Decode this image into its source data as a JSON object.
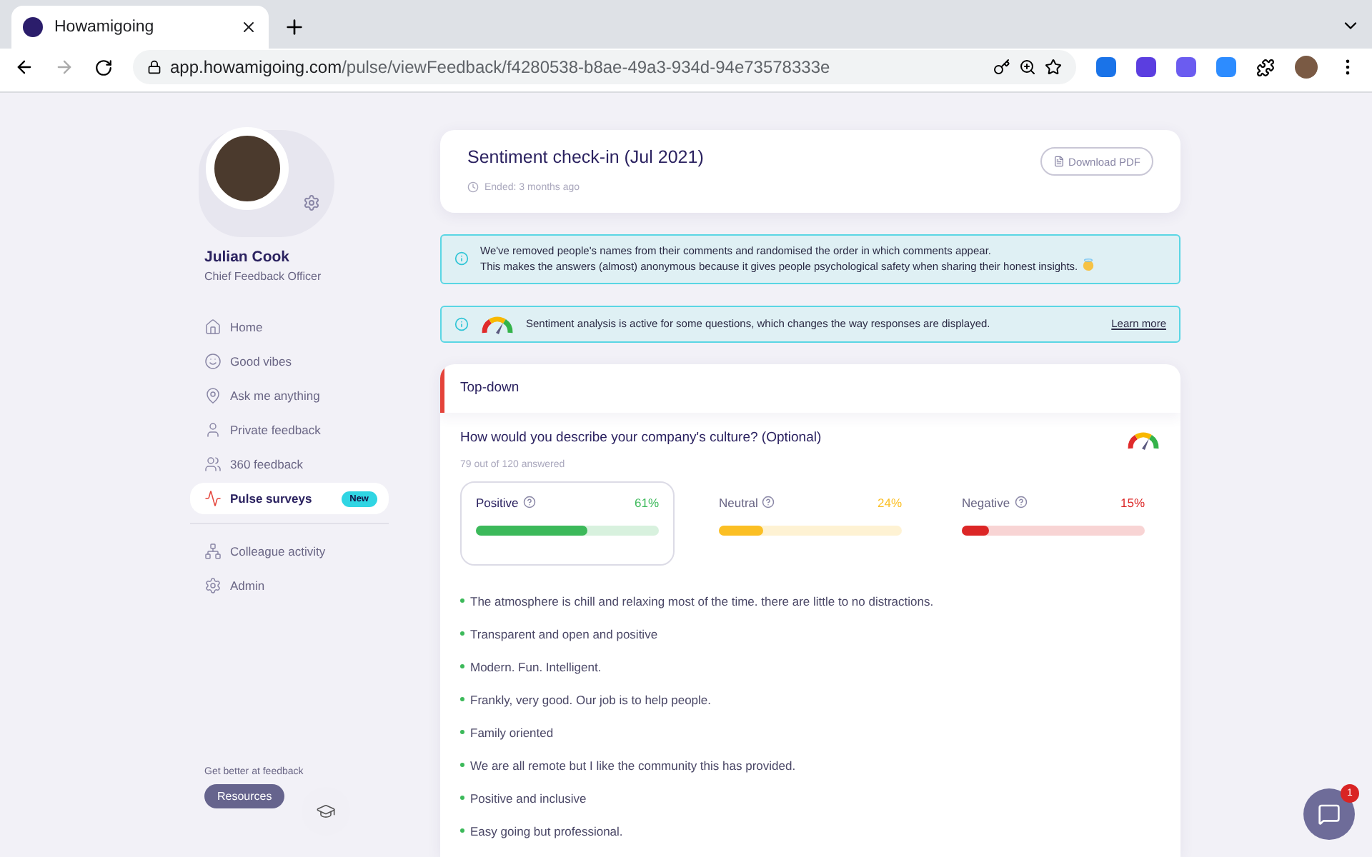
{
  "browser": {
    "tab_title": "Howamigoing",
    "url_domain": "app.howamigoing.com",
    "url_path": "/pulse/viewFeedback/f4280538-b8ae-49a3-934d-94e73578333e"
  },
  "profile": {
    "name": "Julian Cook",
    "role": "Chief Feedback Officer"
  },
  "nav_primary": [
    {
      "label": "Home",
      "selected": false
    },
    {
      "label": "Good vibes",
      "selected": false
    },
    {
      "label": "Ask me anything",
      "selected": false
    },
    {
      "label": "Private feedback",
      "selected": false
    },
    {
      "label": "360 feedback",
      "selected": false
    },
    {
      "label": "Pulse surveys",
      "selected": true,
      "badge": "New"
    }
  ],
  "nav_secondary": [
    {
      "label": "Colleague activity",
      "selected": false
    },
    {
      "label": "Admin",
      "selected": false
    }
  ],
  "resources": {
    "caption": "Get better at feedback",
    "button": "Resources"
  },
  "survey": {
    "title": "Sentiment check-in (Jul 2021)",
    "ended": "Ended: 3 months ago",
    "download": "Download PDF"
  },
  "notices": [
    {
      "lines": [
        "We've removed people's names from their comments and randomised the order in which comments appear.",
        "This makes the answers (almost) anonymous because it gives people psychological safety when sharing their honest insights."
      ]
    },
    {
      "text": "Sentiment analysis is active for some questions, which changes the way responses are displayed.",
      "link": "Learn more"
    }
  ],
  "section": {
    "title": "Top-down",
    "question": "How would you describe your company's culture? (Optional)",
    "answered": "79 out of 120 answered",
    "sentiments": [
      {
        "label": "Positive",
        "percent": "61%",
        "level": 0.61,
        "color": "#3cb95a",
        "selected": true
      },
      {
        "label": "Neutral",
        "percent": "24%",
        "level": 0.24,
        "color": "#fbbf24",
        "selected": false
      },
      {
        "label": "Negative",
        "percent": "15%",
        "level": 0.15,
        "color": "#dc2626",
        "selected": false
      }
    ],
    "comments": [
      "The atmosphere is chill and relaxing most of the time. there are little to no distractions.",
      "Transparent and open and positive",
      "Modern. Fun. Intelligent.",
      "Frankly, very good. Our job is to help people.",
      "Family oriented",
      "We are all remote but I like the community this has provided.",
      "Positive and inclusive",
      "Easy going but professional."
    ]
  },
  "chat": {
    "badge": "1"
  }
}
